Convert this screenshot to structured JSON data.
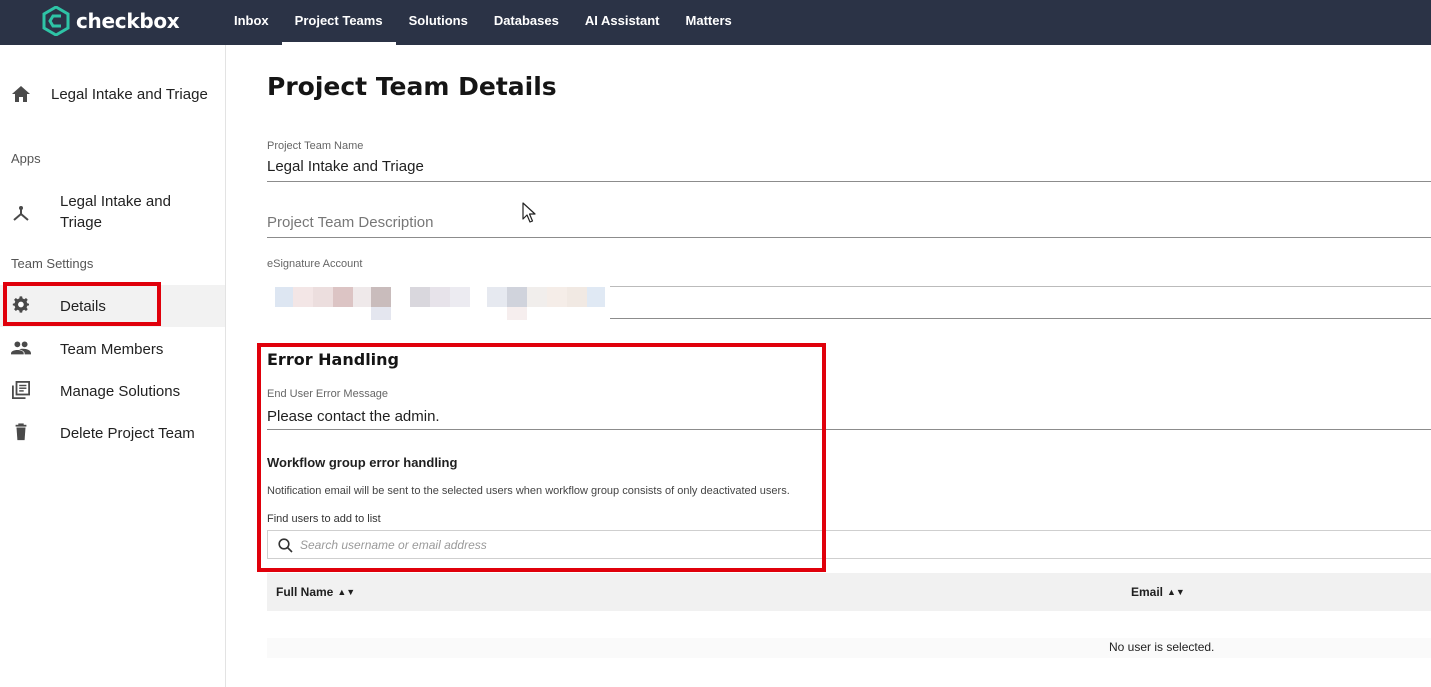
{
  "app": {
    "logo_text": "checkbox",
    "accent_color": "#2ec4a6",
    "topbar_color": "#2b3346"
  },
  "nav": {
    "items": [
      {
        "label": "Inbox"
      },
      {
        "label": "Project Teams"
      },
      {
        "label": "Solutions"
      },
      {
        "label": "Databases"
      },
      {
        "label": "AI Assistant"
      },
      {
        "label": "Matters"
      }
    ],
    "active": "Project Teams"
  },
  "sidebar": {
    "home": {
      "label": "Legal Intake and Triage",
      "icon": "home-icon"
    },
    "apps_heading": "Apps",
    "apps": [
      {
        "label": "Legal Intake and Triage",
        "icon": "fork-icon"
      }
    ],
    "team_settings_heading": "Team Settings",
    "settings": [
      {
        "label": "Details",
        "icon": "gear-icon"
      },
      {
        "label": "Team Members",
        "icon": "people-icon"
      },
      {
        "label": "Manage Solutions",
        "icon": "library-icon"
      },
      {
        "label": "Delete Project Team",
        "icon": "trash-icon"
      }
    ],
    "active": "Details"
  },
  "main": {
    "title": "Project Team Details",
    "team_name": {
      "label": "Project Team Name",
      "value": "Legal Intake and Triage"
    },
    "team_description": {
      "placeholder": "Project Team Description"
    },
    "esignature": {
      "label": "eSignature Account"
    },
    "error_handling": {
      "title": "Error Handling",
      "end_user_message": {
        "label": "End User Error Message",
        "value": "Please contact the admin."
      },
      "workflow_title": "Workflow group error handling",
      "workflow_help": "Notification email will be sent to the selected users when workflow group consists of only deactivated users.",
      "find_label": "Find users to add to list",
      "search_placeholder": "Search username or email address"
    },
    "table": {
      "columns": [
        {
          "label": "Full Name"
        },
        {
          "label": "Email"
        }
      ],
      "sort_glyph": "▲▼",
      "empty_text": "No user is selected."
    }
  },
  "highlight_color": "#e0000b"
}
